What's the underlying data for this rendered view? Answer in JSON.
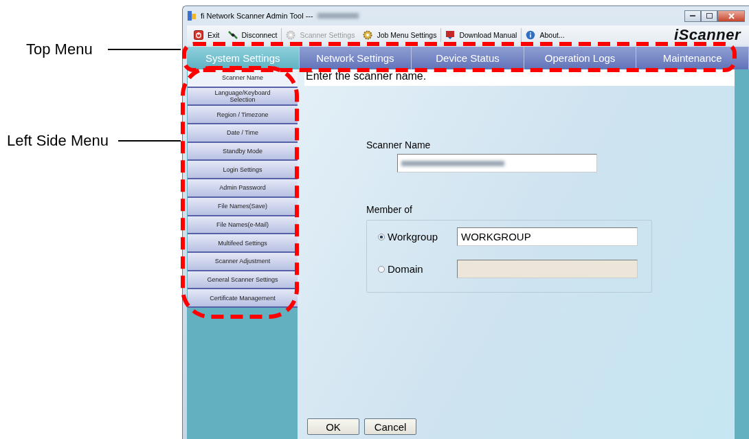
{
  "window": {
    "title": "fi Network Scanner Admin Tool ---"
  },
  "callouts": [
    {
      "label": "Top Menu"
    },
    {
      "label": "Left Side Menu"
    }
  ],
  "toolbar": [
    {
      "label": "Exit",
      "kind": "power",
      "disabled": false
    },
    {
      "label": "Disconnect",
      "kind": "plug",
      "disabled": false
    },
    {
      "label": "Scanner Settings",
      "kind": "gear",
      "disabled": true
    },
    {
      "label": "Job Menu Settings",
      "kind": "gear",
      "disabled": false
    },
    {
      "label": "Download Manual",
      "kind": "pdf",
      "disabled": false
    },
    {
      "label": "About...",
      "kind": "info",
      "disabled": false
    }
  ],
  "brand": "iScanner",
  "tabs": [
    {
      "label": "System Settings",
      "selected": true
    },
    {
      "label": "Network Settings",
      "selected": false
    },
    {
      "label": "Device Status",
      "selected": false
    },
    {
      "label": "Operation Logs",
      "selected": false
    },
    {
      "label": "Maintenance",
      "selected": false
    }
  ],
  "side_menu": [
    {
      "label": "Scanner Name",
      "selected": true
    },
    {
      "label": "Language/Keyboard Selection",
      "selected": false
    },
    {
      "label": "Region / Timezone",
      "selected": false
    },
    {
      "label": "Date / Time",
      "selected": false
    },
    {
      "label": "Standby Mode",
      "selected": false
    },
    {
      "label": "Login Settings",
      "selected": false
    },
    {
      "label": "Admin Password",
      "selected": false
    },
    {
      "label": "File Names(Save)",
      "selected": false
    },
    {
      "label": "File Names(e-Mail)",
      "selected": false
    },
    {
      "label": "Multifeed Settings",
      "selected": false
    },
    {
      "label": "Scanner Adjustment",
      "selected": false
    },
    {
      "label": "General Scanner Settings",
      "selected": false
    },
    {
      "label": "Certificate Management",
      "selected": false
    }
  ],
  "instruction": "Enter the scanner name.",
  "scanner_name": {
    "label": "Scanner Name"
  },
  "member_of": {
    "label": "Member of",
    "options": [
      {
        "label": "Workgroup",
        "selected": true,
        "value": "WORKGROUP",
        "disabled": false
      },
      {
        "label": "Domain",
        "selected": false,
        "disabled": true
      }
    ]
  },
  "buttons": [
    "OK",
    "Cancel"
  ]
}
